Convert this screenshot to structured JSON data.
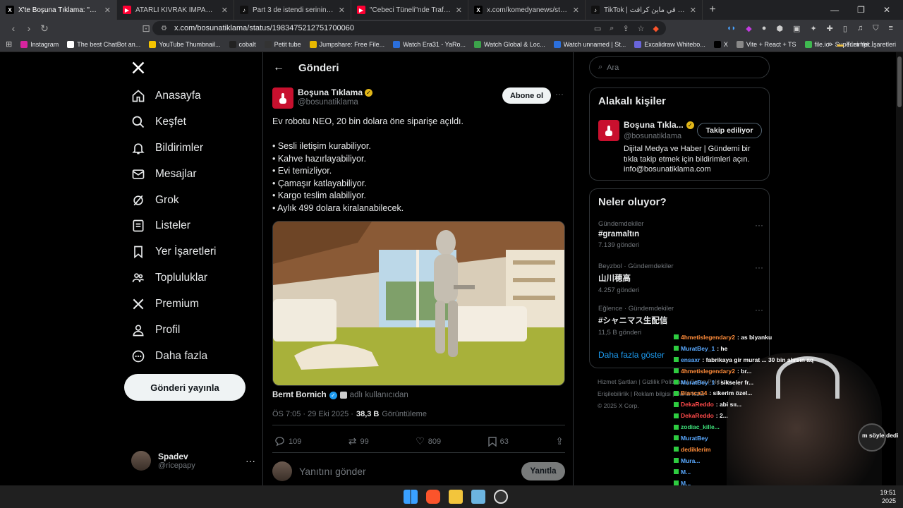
{
  "browser": {
    "tabs": [
      {
        "title": "X'te Boşuna Tıklama: \"Ev robotu",
        "fav": "X",
        "color": "#000000",
        "active": true
      },
      {
        "title": "ATARLI KIVRAK İMPARATOR - YouTube",
        "fav": "▶",
        "color": "#ff0033",
        "active": false
      },
      {
        "title": "Part 3 de istendi serinin sonu KDKSK",
        "fav": "♪",
        "color": "#111111",
        "active": false
      },
      {
        "title": "\"Cebeci Tüneli\"nde Trafik Polisi Opera",
        "fav": "▶",
        "color": "#ff0033",
        "active": false
      },
      {
        "title": "x.com/komedyanews/status/198314...",
        "fav": "X",
        "color": "#000000",
        "active": false
      },
      {
        "title": "TikTok | يتغير كل شيء في ماين كرافت",
        "fav": "♪",
        "color": "#111111",
        "active": false
      }
    ],
    "new_tab": "+",
    "url": "x.com/bosunatiklama/status/1983475212751700060",
    "bookmarks": [
      {
        "label": "Instagram",
        "color": "#d6249f"
      },
      {
        "label": "The best ChatBot an...",
        "color": "#ffffff"
      },
      {
        "label": "YouTube Thumbnail...",
        "color": "#f5c400"
      },
      {
        "label": "cobalt",
        "color": "#222222"
      },
      {
        "label": "Petit tube",
        "color": "#333333"
      },
      {
        "label": "Jumpshare: Free File...",
        "color": "#e8b800"
      },
      {
        "label": "Watch Era31 - YaRo...",
        "color": "#2b6fdc"
      },
      {
        "label": "Watch Global & Loc...",
        "color": "#3ca34b"
      },
      {
        "label": "Watch unnamed | St...",
        "color": "#2b6fdc"
      },
      {
        "label": "Excalidraw Whitebo...",
        "color": "#6965db"
      },
      {
        "label": "X",
        "color": "#000000"
      },
      {
        "label": "Vite + React + TS",
        "color": "#888888"
      },
      {
        "label": "file.io - Super simpl...",
        "color": "#3fb950"
      }
    ],
    "bookmarks_more": "»",
    "all_bookmarks": "Tüm Yer İşaretleri"
  },
  "nav": {
    "items": [
      {
        "label": "Anasayfa",
        "icon": "home-icon"
      },
      {
        "label": "Keşfet",
        "icon": "search-icon"
      },
      {
        "label": "Bildirimler",
        "icon": "bell-icon"
      },
      {
        "label": "Mesajlar",
        "icon": "mail-icon"
      },
      {
        "label": "Grok",
        "icon": "grok-icon"
      },
      {
        "label": "Listeler",
        "icon": "list-icon"
      },
      {
        "label": "Yer İşaretleri",
        "icon": "bookmark-icon"
      },
      {
        "label": "Topluluklar",
        "icon": "communities-icon"
      },
      {
        "label": "Premium",
        "icon": "x-logo-icon"
      },
      {
        "label": "Profil",
        "icon": "profile-icon"
      },
      {
        "label": "Daha fazla",
        "icon": "more-circle-icon"
      }
    ],
    "post_button": "Gönderi yayınla",
    "account": {
      "name": "Spadev",
      "handle": "@ricepapy"
    }
  },
  "post": {
    "header_title": "Gönderi",
    "author_name": "Boşuna Tıklama",
    "author_handle": "@bosunatiklama",
    "subscribe": "Abone ol",
    "text_lines": [
      "Ev robotu NEO, 20 bin dolara öne siparişe açıldı.",
      "",
      "• Sesli iletişim kurabiliyor.",
      "• Kahve hazırlayabiliyor.",
      "• Evi temizliyor.",
      "• Çamaşır katlayabiliyor.",
      "• Kargo teslim alabiliyor.",
      "• Aylık 499 dolara kiralanabilecek."
    ],
    "media_credit_name": "Bernt Bornich",
    "media_credit_sub": "adlı kullanıcıdan",
    "time": "ÖS 7:05 · 29 Eki 2025 ·",
    "views": "38,3 B",
    "views_label": "Görüntüleme",
    "stats": {
      "replies": "109",
      "reposts": "99",
      "likes": "809",
      "bookmarks": "63"
    },
    "reply_placeholder": "Yanıtını gönder",
    "reply_button": "Yanıtla"
  },
  "sidebar": {
    "search_placeholder": "Ara",
    "related_title": "Alakalı kişiler",
    "related": {
      "name": "Boşuna Tıkla...",
      "handle": "@bosunatiklama",
      "button": "Takip ediliyor",
      "bio": "Dijital Medya ve Haber | Gündemi bir tıkla takip etmek için bildirimleri açın. info@bosunatiklama.com"
    },
    "trends_title": "Neler oluyor?",
    "trends": [
      {
        "category": "Gündemdekiler",
        "title": "#gramaltın",
        "count": "7.139 gönderi"
      },
      {
        "category": "Beyzbol · Gündemdekiler",
        "title": "山川穂高",
        "count": "4.257 gönderi"
      },
      {
        "category": "Eğlence · Gündemdekiler",
        "title": "#シャニマス生配信",
        "count": "11,5 B gönderi"
      }
    ],
    "show_more": "Daha fazla göster",
    "footer_lines": [
      "Hizmet Şartları  |  Gizlilik Politikası  |  Çerez Politikası",
      "Erişilebilirlik  |  Reklam bilgisi  |  Daha fazla ···",
      "© 2025 X Corp."
    ]
  },
  "overlay": {
    "chat": [
      {
        "user": "4hmetislegendary2",
        "msg": ": as biyanku",
        "c": ""
      },
      {
        "user": "MuratBey_1",
        "msg": ": he",
        "c": "b"
      },
      {
        "user": "ensaxr",
        "msg": ": fabrikaya gir murat ... 30 bin alırsın aq",
        "c": "b"
      },
      {
        "user": "4hmetislegendary2",
        "msg": ": br...",
        "c": ""
      },
      {
        "user": "MuratBey_1",
        "msg": ": sikseler fr...",
        "c": "b"
      },
      {
        "user": "Bianca34",
        "msg": ": sikerim özel...",
        "c": ""
      },
      {
        "user": "DekaReddo",
        "msg": ": abi sıı...",
        "c": "r"
      },
      {
        "user": "DekaReddo",
        "msg": ": 2...",
        "c": "r"
      },
      {
        "user": "zodiac_kille...",
        "msg": "",
        "c": "g"
      },
      {
        "user": "MuratBey",
        "msg": "",
        "c": "b"
      },
      {
        "user": "dediklerim",
        "msg": "",
        "c": ""
      },
      {
        "user": "Mura...",
        "msg": "",
        "c": "b"
      },
      {
        "user": "M...",
        "msg": "",
        "c": "b"
      },
      {
        "user": "M...",
        "msg": "",
        "c": "b"
      }
    ],
    "side_text": "m söyle dedi"
  },
  "taskbar": {
    "time": "19:51",
    "date": "2025"
  }
}
